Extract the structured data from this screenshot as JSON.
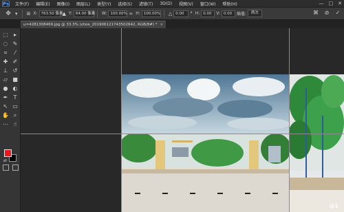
{
  "menubar": {
    "logo": "Ps",
    "items": [
      "文件(F)",
      "编辑(E)",
      "图像(I)",
      "图层(L)",
      "类型(Y)",
      "选择(S)",
      "滤镜(T)",
      "3D(D)",
      "视图(V)",
      "窗口(W)",
      "帮助(H)"
    ],
    "window_controls": [
      "—",
      "□",
      "✕"
    ]
  },
  "options": {
    "tool_icon": "move-tool-icon",
    "x_label": "X:",
    "x_value": "763.50 像素",
    "y_label": "Y:",
    "y_value": "64.00 像素",
    "w_label": "W:",
    "w_value": "100.00%",
    "h_label": "H:",
    "h_value": "100.00%",
    "angle_value": "0.00",
    "h_skew_label": "H:",
    "h_skew_value": "0.00",
    "v_skew_label": "V:",
    "v_skew_value": "0.00",
    "interp_label": "插值:",
    "interp_value": "两次"
  },
  "tab": {
    "title": "u=4281308469.jpg @ 33.3% (shoe_201906121743502642, RGB/8#) *",
    "close": "×"
  },
  "colors": {
    "foreground": "#e8161f",
    "background": "#000000",
    "accent": "#2f7ad6"
  },
  "watermark": "@1"
}
